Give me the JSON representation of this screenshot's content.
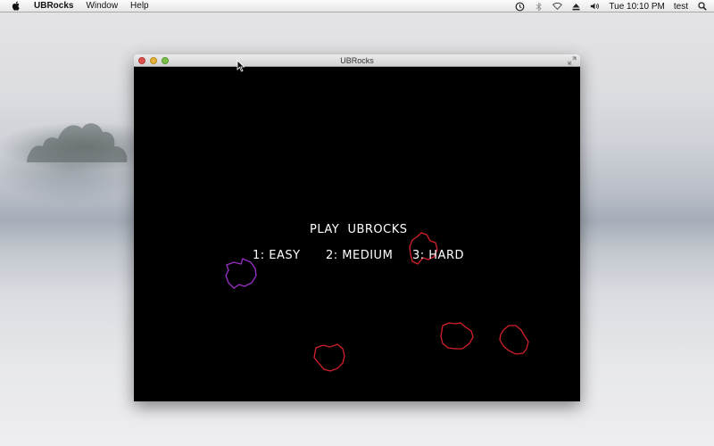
{
  "menubar": {
    "app_name": "UBRocks",
    "menus": [
      "Window",
      "Help"
    ],
    "clock": "Tue 10:10 PM",
    "user": "test"
  },
  "window": {
    "title": "UBRocks"
  },
  "game": {
    "title": "PLAY  UBROCKS",
    "options": {
      "easy": "1: EASY",
      "medium": "2: MEDIUM",
      "hard": "3: HARD"
    },
    "colors": {
      "background": "#000000",
      "text": "#ffffff",
      "rock_red": "#d4202a",
      "rock_purple": "#9b2fc9"
    }
  },
  "icons": {
    "menubar": [
      "apple-icon",
      "time-machine-icon",
      "bluetooth-icon",
      "wifi-icon",
      "eject-icon",
      "volume-icon",
      "search-icon"
    ],
    "window": [
      "close-icon",
      "minimize-icon",
      "zoom-icon",
      "fullscreen-icon"
    ]
  }
}
